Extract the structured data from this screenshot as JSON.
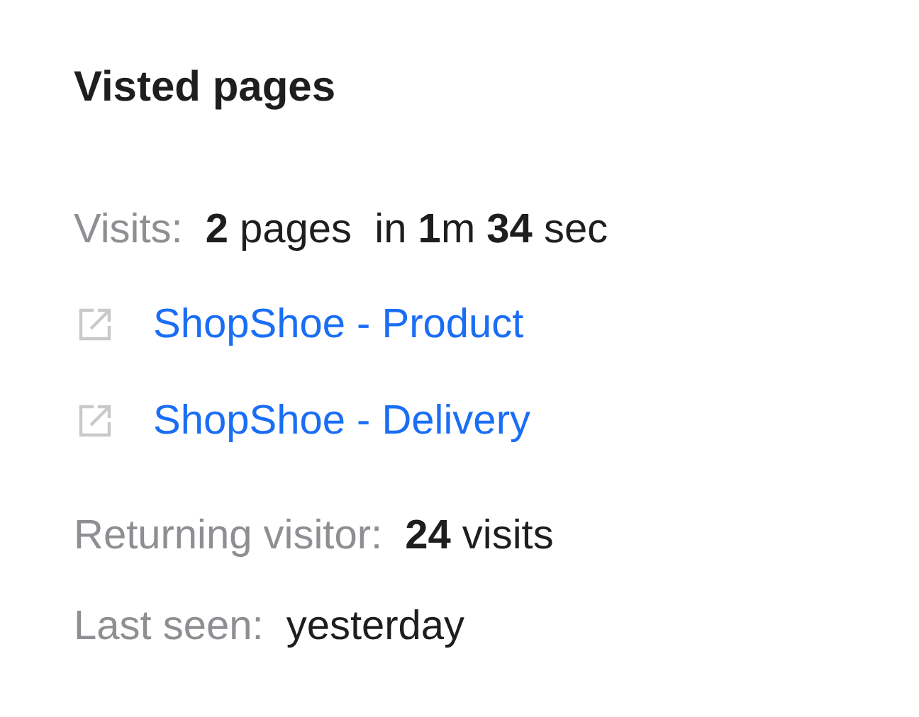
{
  "title": "Visted pages",
  "visits": {
    "label": "Visits:",
    "value": "**2** pages  in **1**m **34** sec"
  },
  "pages": [
    {
      "title": "ShopShoe - Product"
    },
    {
      "title": "ShopShoe - Delivery"
    }
  ],
  "returning": {
    "label": "Returning visitor:",
    "value": "**24** visits"
  },
  "last_seen": {
    "label": "Last seen:",
    "value": "yesterday"
  }
}
